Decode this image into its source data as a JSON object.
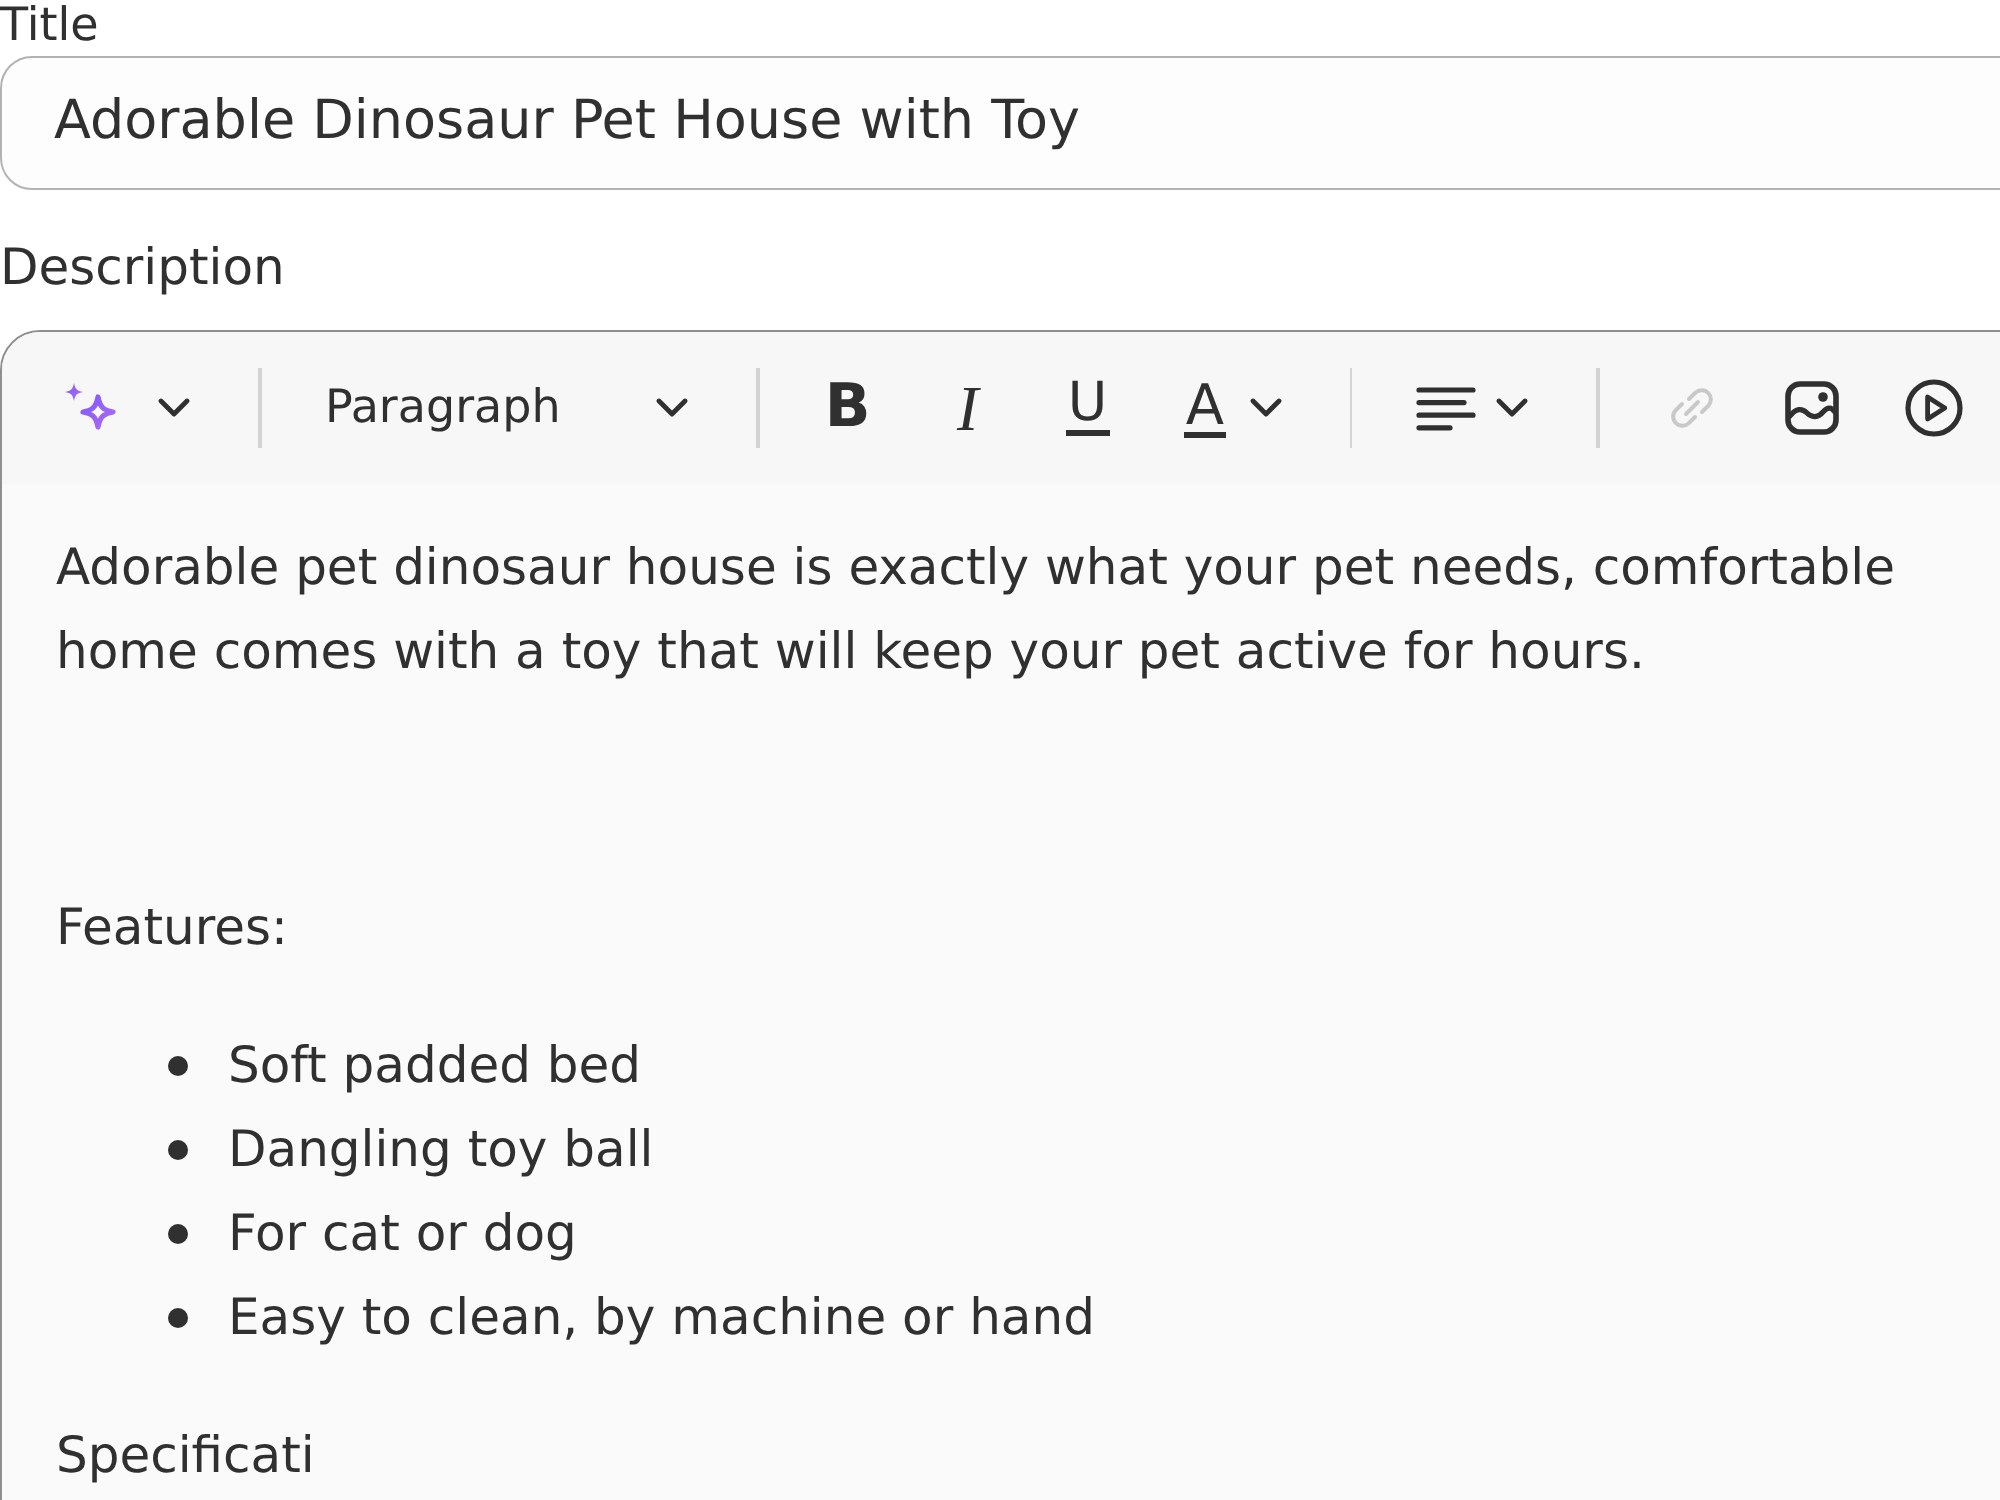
{
  "title_field": {
    "label": "Title",
    "value": "Adorable Dinosaur Pet House with Toy"
  },
  "description": {
    "label": "Description",
    "toolbar": [
      [
        {
          "kind": "ai",
          "menu": true,
          "disabled": false
        }
      ],
      [
        {
          "kind": "format",
          "label": "Paragraph",
          "menu": true,
          "disabled": false
        }
      ],
      [
        {
          "kind": "bold",
          "label": "B",
          "menu": false,
          "disabled": false
        },
        {
          "kind": "italic",
          "label": "I",
          "menu": false,
          "disabled": false
        },
        {
          "kind": "underline",
          "label": "U",
          "menu": false,
          "disabled": false
        },
        {
          "kind": "text_color",
          "label": "A",
          "menu": true,
          "disabled": false
        }
      ],
      [
        {
          "kind": "align",
          "menu": true,
          "disabled": false
        }
      ],
      [
        {
          "kind": "link",
          "menu": false,
          "disabled": true
        },
        {
          "kind": "image",
          "menu": false,
          "disabled": false
        },
        {
          "kind": "video",
          "menu": false,
          "disabled": false
        }
      ]
    ],
    "content": [
      {
        "kind": "paragraph",
        "text": "Adorable pet dinosaur house is exactly what your pet needs, comfortable home comes with a toy that will keep your pet active for hours."
      },
      {
        "kind": "blank"
      },
      {
        "kind": "paragraph",
        "text": "Features:"
      },
      {
        "kind": "bullet_list",
        "items": [
          "Soft padded bed",
          "Dangling toy ball",
          "For cat or dog",
          "Easy to clean, by machine or hand"
        ]
      },
      {
        "kind": "paragraph",
        "text": "Specificati"
      }
    ]
  }
}
